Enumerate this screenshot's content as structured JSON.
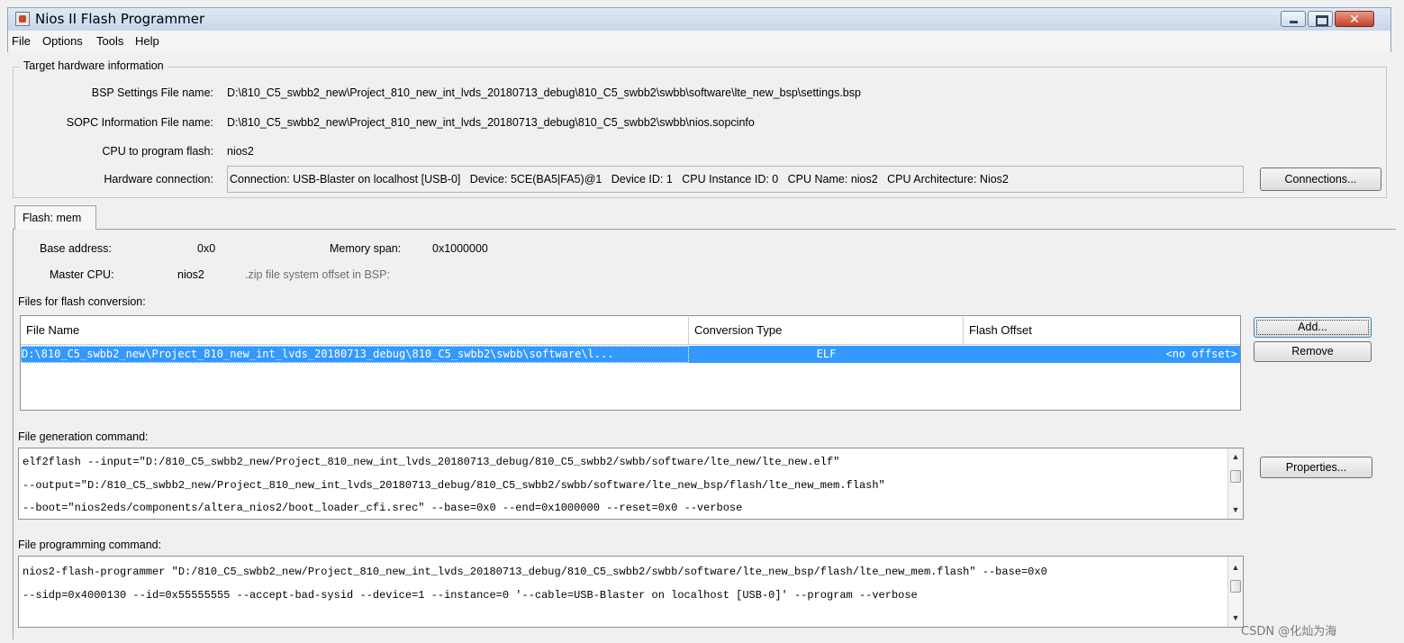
{
  "window": {
    "title": "Nios II Flash Programmer",
    "close_glyph": "✕"
  },
  "menu": {
    "items": [
      "File",
      "Options",
      "Tools",
      "Help"
    ]
  },
  "target_hardware": {
    "legend": "Target hardware information",
    "bsp_label": "BSP Settings File name:",
    "bsp_value": "D:\\810_C5_swbb2_new\\Project_810_new_int_lvds_20180713_debug\\810_C5_swbb2\\swbb\\software\\lte_new_bsp\\settings.bsp",
    "sopc_label": "SOPC Information File name:",
    "sopc_value": "D:\\810_C5_swbb2_new\\Project_810_new_int_lvds_20180713_debug\\810_C5_swbb2\\swbb\\nios.sopcinfo",
    "cpu_label": "CPU to program flash:",
    "cpu_value": "nios2",
    "hw_conn_label": "Hardware connection:",
    "hw_conn_value": "Connection: USB-Blaster on localhost [USB-0]   Device: 5CE(BA5|FA5)@1   Device ID: 1   CPU Instance ID: 0   CPU Name: nios2   CPU Architecture: Nios2",
    "connections_button": "Connections..."
  },
  "tab": {
    "label": "Flash: mem"
  },
  "flash": {
    "base_address_label": "Base address:",
    "base_address_value": "0x0",
    "memory_span_label": "Memory span:",
    "memory_span_value": "0x1000000",
    "master_cpu_label": "Master CPU:",
    "master_cpu_value": "nios2",
    "zip_offset_label": ".zip file system offset in BSP:"
  },
  "files": {
    "section_label": "Files for flash conversion:",
    "columns": [
      "File Name",
      "Conversion Type",
      "Flash Offset"
    ],
    "rows": [
      {
        "file_name": "D:\\810_C5_swbb2_new\\Project_810_new_int_lvds_20180713_debug\\810_C5_swbb2\\swbb\\software\\l...",
        "conversion_type": "ELF",
        "flash_offset": "<no offset>"
      }
    ],
    "add_button": "Add...",
    "remove_button": "Remove"
  },
  "generation": {
    "label": "File generation command:",
    "lines": [
      "elf2flash --input=\"D:/810_C5_swbb2_new/Project_810_new_int_lvds_20180713_debug/810_C5_swbb2/swbb/software/lte_new/lte_new.elf\"",
      "--output=\"D:/810_C5_swbb2_new/Project_810_new_int_lvds_20180713_debug/810_C5_swbb2/swbb/software/lte_new_bsp/flash/lte_new_mem.flash\"",
      "--boot=\"nios2eds/components/altera_nios2/boot_loader_cfi.srec\" --base=0x0 --end=0x1000000 --reset=0x0 --verbose"
    ],
    "properties_button": "Properties..."
  },
  "programming": {
    "label": "File programming command:",
    "lines": [
      "nios2-flash-programmer \"D:/810_C5_swbb2_new/Project_810_new_int_lvds_20180713_debug/810_C5_swbb2/swbb/software/lte_new_bsp/flash/lte_new_mem.flash\" --base=0x0",
      "--sidp=0x4000130 --id=0x55555555 --accept-bad-sysid --device=1 --instance=0 '--cable=USB-Blaster on localhost [USB-0]' --program --verbose"
    ]
  },
  "scroll_glyphs": {
    "up": "▲",
    "down": "▼"
  },
  "watermark": "CSDN @化灿为海",
  "colors": {
    "selection": "#3399ff",
    "window_bg": "#f0f0f0",
    "title_gradient_top": "#dfe9f5",
    "close_button": "#c4402a"
  }
}
